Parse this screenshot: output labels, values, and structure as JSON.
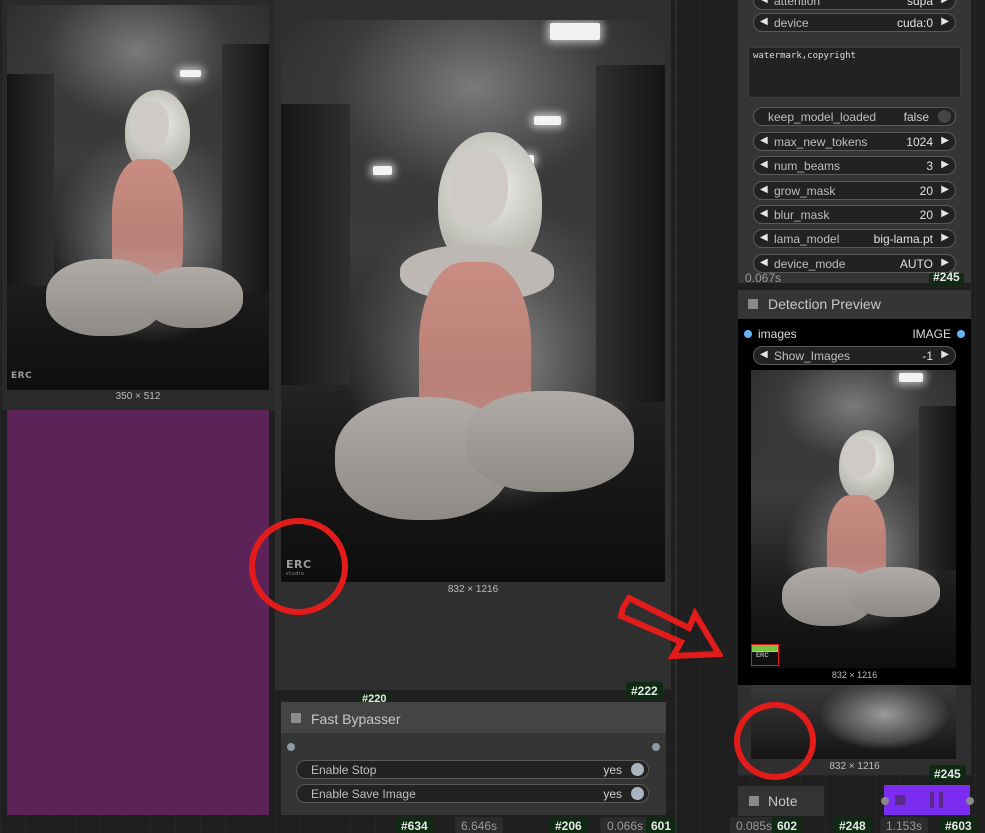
{
  "left_preview": {
    "dims": "350 × 512",
    "logo": "ERC"
  },
  "main_preview": {
    "dims": "832 × 1216",
    "logo": "ERC",
    "logo_sub": "studio"
  },
  "node_220": {
    "id": "#220"
  },
  "node_222": {
    "id": "#222"
  },
  "fast_bypasser": {
    "title": "Fast Bypasser",
    "widgets": [
      {
        "label": "Enable Stop",
        "value": "yes"
      },
      {
        "label": "Enable Save Image",
        "value": "yes"
      }
    ]
  },
  "bottom_left_bar": {
    "badge_634": "#634",
    "time_1": "6.646s",
    "badge_206": "#206",
    "time_2": "0.066s",
    "badge_601": "601"
  },
  "right_node": {
    "top_widgets": [
      {
        "label": "attention",
        "value": "sdpa"
      },
      {
        "label": "device",
        "value": "cuda:0"
      }
    ],
    "textarea": "watermark,copyright",
    "keep_model_loaded": {
      "label": "keep_model_loaded",
      "value": "false"
    },
    "widgets": [
      {
        "label": "max_new_tokens",
        "value": "1024"
      },
      {
        "label": "num_beams",
        "value": "3"
      },
      {
        "label": "grow_mask",
        "value": "20"
      },
      {
        "label": "blur_mask",
        "value": "20"
      },
      {
        "label": "lama_model",
        "value": "big-lama.pt"
      },
      {
        "label": "device_mode",
        "value": "AUTO"
      }
    ],
    "time": "0.067s",
    "id": "#245"
  },
  "detection_preview": {
    "title": "Detection Preview",
    "input_label": "images",
    "input_type": "IMAGE",
    "widget": {
      "label": "Show_Images",
      "value": "-1"
    },
    "dims": "832 × 1216",
    "logo": "ERC"
  },
  "lower_preview": {
    "dims": "832 × 1216",
    "id": "#245"
  },
  "note_node": {
    "title": "Note"
  },
  "bottom_right_bar": {
    "time_1": "0.085s",
    "badge_602": "602",
    "badge_248": "#248",
    "time_2": "1.153s",
    "badge_603": "#603"
  },
  "colors": {
    "accent_purple": "#7a2cf0",
    "purple_panel": "#5b2358",
    "annotation_red": "#e21b1b",
    "badge_green": "#0f2a12"
  }
}
